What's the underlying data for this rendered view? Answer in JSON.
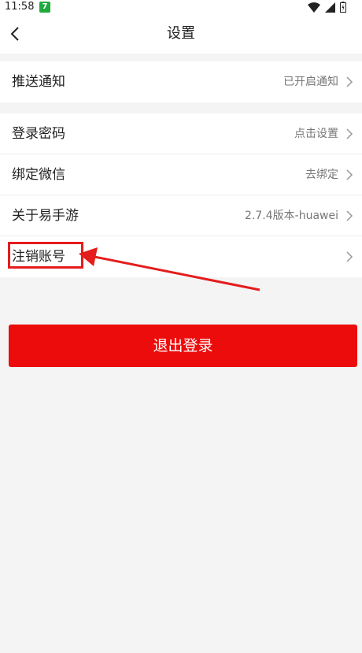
{
  "status_bar": {
    "time": "11:58",
    "app_badge": "7"
  },
  "header": {
    "title": "设置"
  },
  "groups": [
    {
      "rows": [
        {
          "label": "推送通知",
          "value": "已开启通知"
        }
      ]
    },
    {
      "rows": [
        {
          "label": "登录密码",
          "value": "点击设置"
        },
        {
          "label": "绑定微信",
          "value": "去绑定"
        },
        {
          "label": "关于易手游",
          "value": "2.7.4版本-huawei"
        },
        {
          "label": "注销账号",
          "value": ""
        }
      ]
    }
  ],
  "logout_button": {
    "label": "退出登录"
  },
  "colors": {
    "accent": "#ec0c0c",
    "annotation": "#e51c1c",
    "background": "#f4f4f4"
  },
  "icons": [
    "back-arrow-icon",
    "chevron-right-icon",
    "wifi-icon",
    "signal-icon",
    "battery-icon"
  ]
}
